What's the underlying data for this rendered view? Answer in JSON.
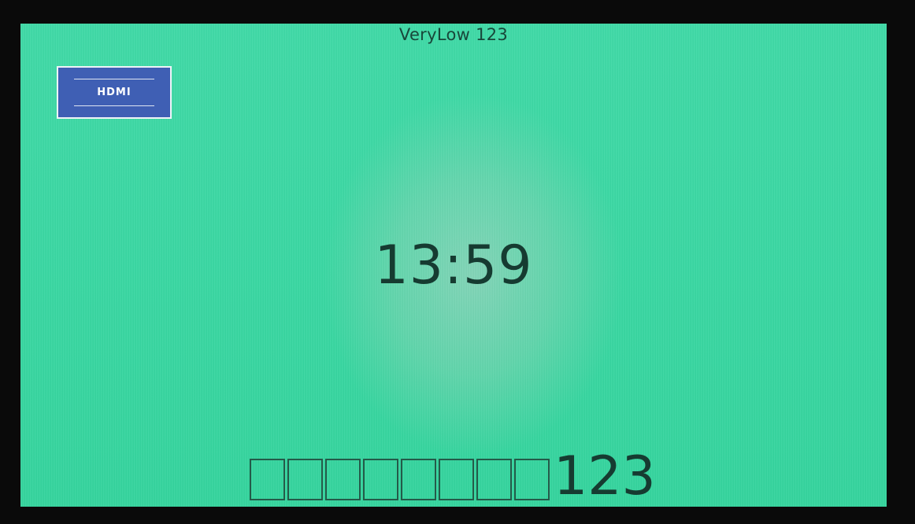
{
  "screen": {
    "title": "VeryLow 123",
    "source_button": {
      "label": "HDMI",
      "color": "#3f5fb4"
    },
    "clock": "13:59",
    "footer": {
      "empty_slot_count": 8,
      "value": "123"
    },
    "background_color": "#3fd9a6"
  }
}
